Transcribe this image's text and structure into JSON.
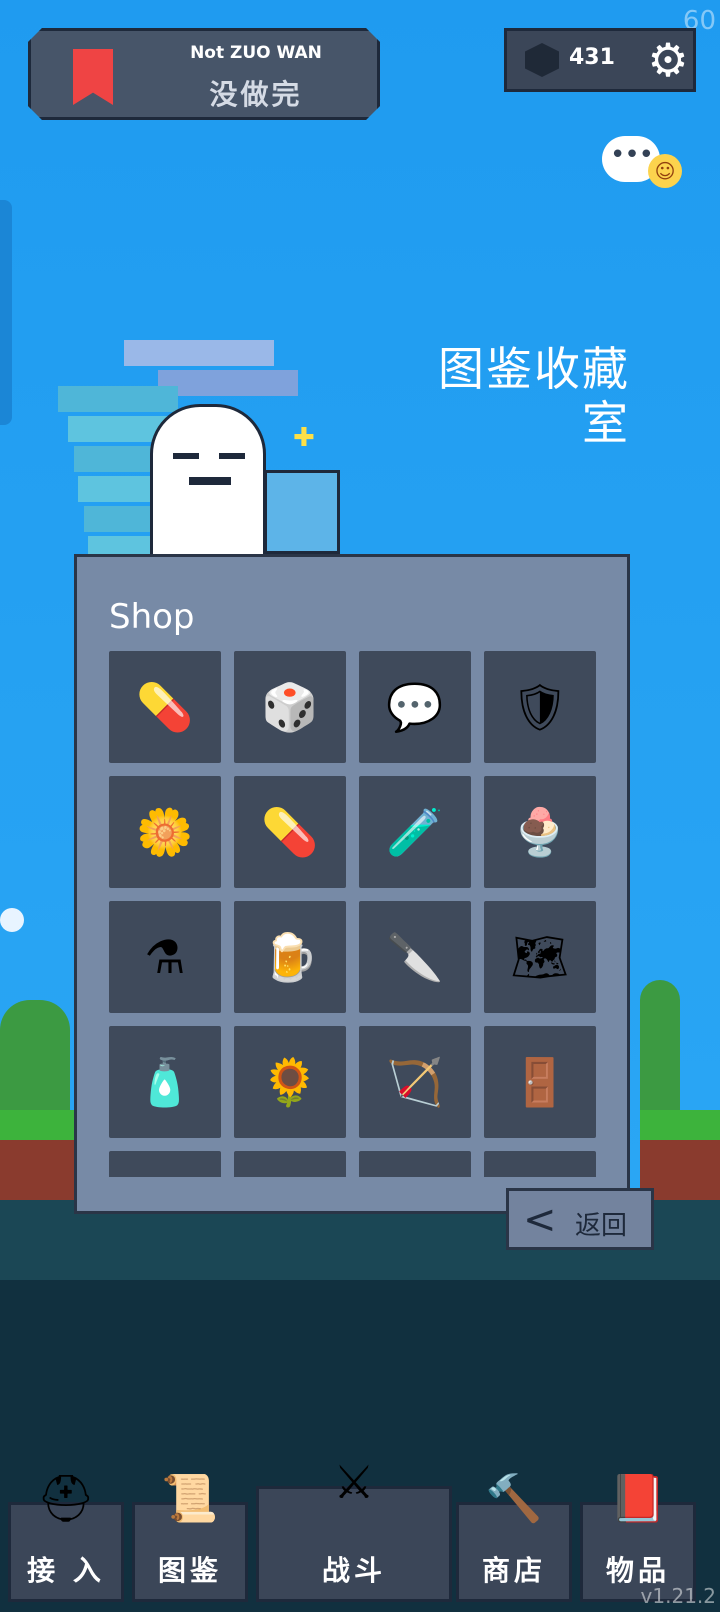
{
  "fps": "60",
  "version": "v1.21.2",
  "header": {
    "title_en": "Not ZUO WAN",
    "title_zh": "没做完",
    "currency_value": "431",
    "currency_icon": "gem-icon",
    "settings_icon": "gear-icon"
  },
  "room": {
    "title_line1": "图鉴收藏",
    "title_line2": "室"
  },
  "shop": {
    "title": "Shop",
    "items": [
      {
        "icon": "capsule-red-icon",
        "glyph": "💊"
      },
      {
        "icon": "dice-icon",
        "glyph": "🎲"
      },
      {
        "icon": "chat-bubbles-icon",
        "glyph": "💬"
      },
      {
        "icon": "round-shield-icon",
        "glyph": "🛡"
      },
      {
        "icon": "daisy-flower-icon",
        "glyph": "🌼"
      },
      {
        "icon": "capsule-blue-icon",
        "glyph": "💊"
      },
      {
        "icon": "potion-flask-icon",
        "glyph": "🧪"
      },
      {
        "icon": "ice-cream-icon",
        "glyph": "🍨"
      },
      {
        "icon": "herb-flask-icon",
        "glyph": "⚗"
      },
      {
        "icon": "beer-mug-icon",
        "glyph": "🍺"
      },
      {
        "icon": "knife-icon",
        "glyph": "🔪"
      },
      {
        "icon": "map-icon",
        "glyph": "🗺"
      },
      {
        "icon": "green-potion-icon",
        "glyph": "🧴"
      },
      {
        "icon": "sunflower-icon",
        "glyph": "🌻"
      },
      {
        "icon": "bow-arrow-icon",
        "glyph": "🏹"
      },
      {
        "icon": "tombstone-door-icon",
        "glyph": "🚪"
      },
      {
        "icon": "",
        "glyph": ""
      },
      {
        "icon": "",
        "glyph": ""
      },
      {
        "icon": "",
        "glyph": ""
      },
      {
        "icon": "",
        "glyph": ""
      }
    ]
  },
  "back_button": {
    "label": "返回",
    "arrow": "<"
  },
  "nav": [
    {
      "label": "接 入",
      "icon": "knight-helmet-icon",
      "glyph": "⛑"
    },
    {
      "label": "图鉴",
      "icon": "scroll-icon",
      "glyph": "📜"
    },
    {
      "label": "战斗",
      "icon": "crossed-swords-icon",
      "glyph": "⚔"
    },
    {
      "label": "商店",
      "icon": "hammer-icon",
      "glyph": "🔨"
    },
    {
      "label": "物品",
      "icon": "spellbook-icon",
      "glyph": "📕"
    }
  ],
  "colors": {
    "sky": "#1f9cf0",
    "panel": "#778aa6",
    "cell": "#3f4a5b",
    "plate": "#475569",
    "accent_red": "#ef4444"
  }
}
